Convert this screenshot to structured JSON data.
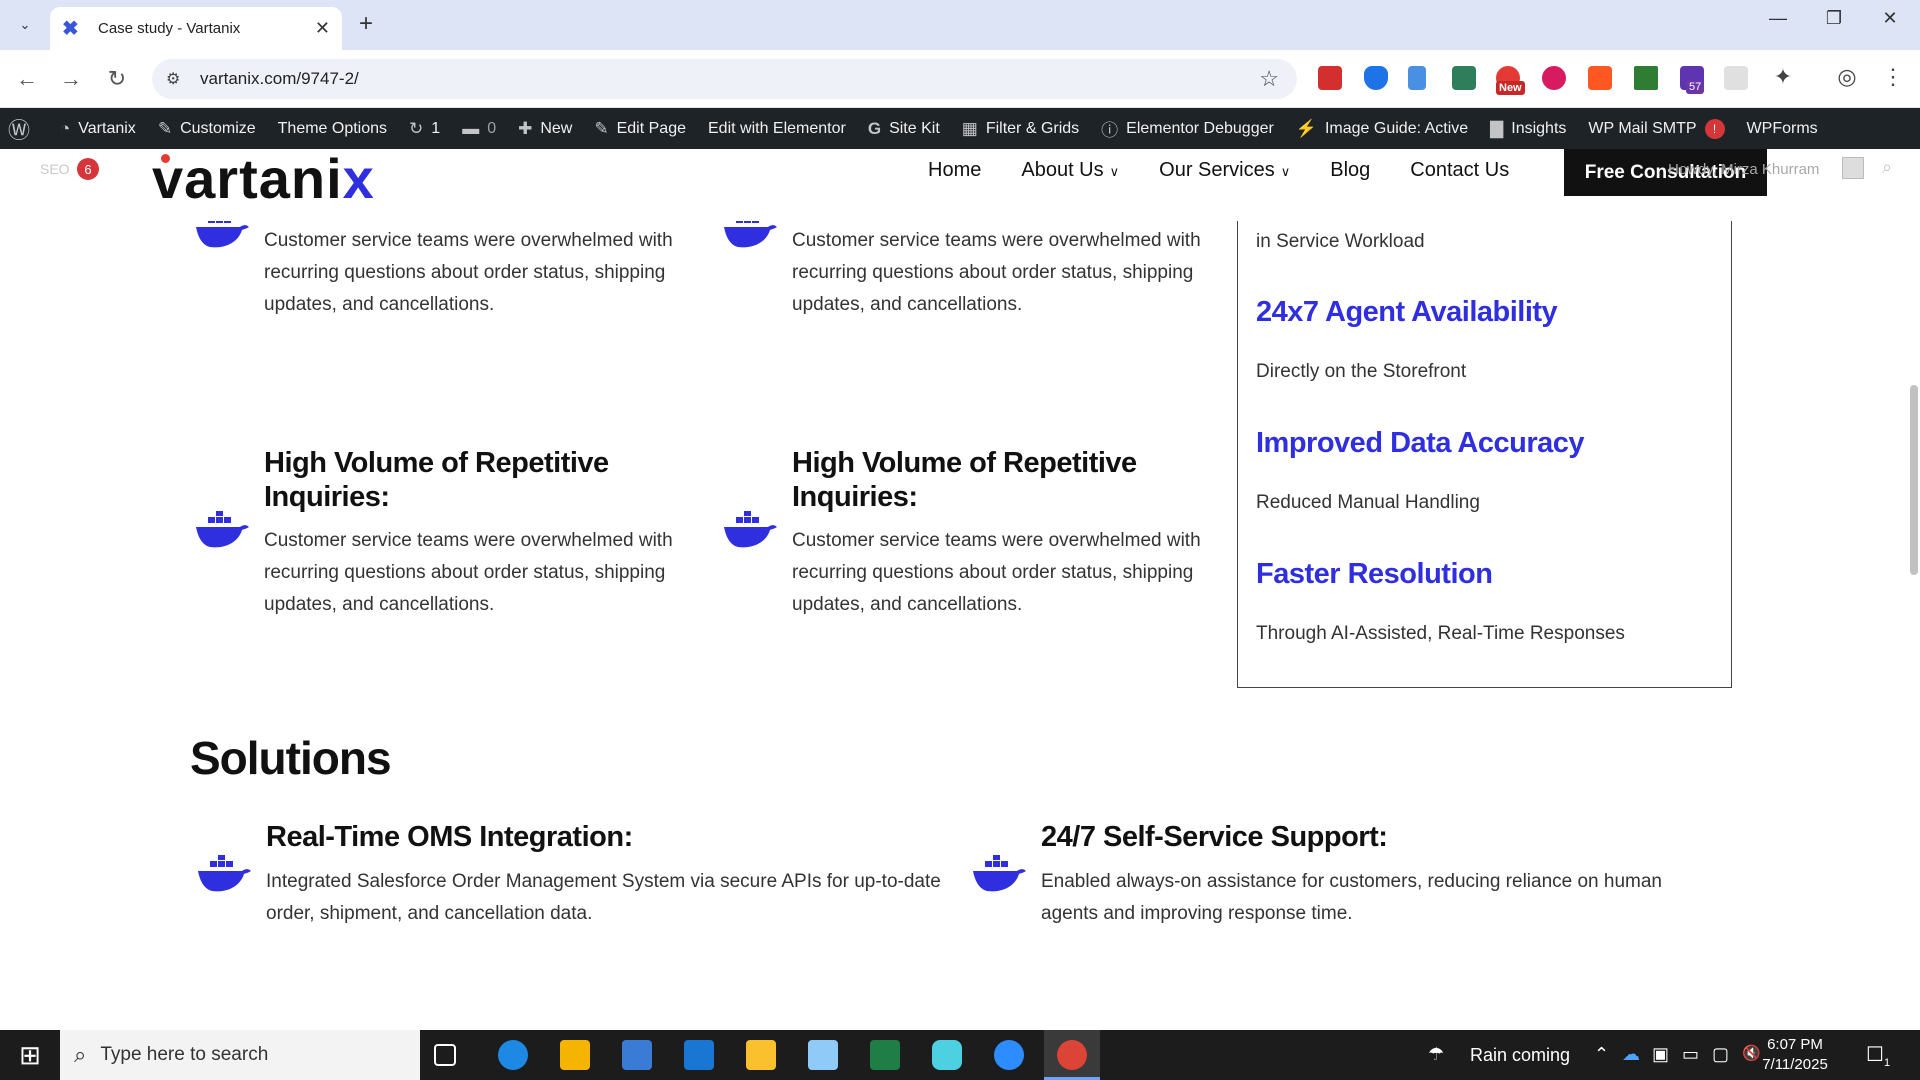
{
  "browser": {
    "tab_title": "Case study - Vartanix",
    "url": "vartanix.com/9747-2/",
    "extension_new_badge": "New",
    "extension_count": "57"
  },
  "adminbar": {
    "site_name": "Vartanix",
    "customize": "Customize",
    "theme_options": "Theme Options",
    "updates_count": "1",
    "comments_count": "0",
    "new": "New",
    "edit_page": "Edit Page",
    "edit_elementor": "Edit with Elementor",
    "site_kit": "Site Kit",
    "filter_grids": "Filter & Grids",
    "elementor_debugger": "Elementor Debugger",
    "image_guide": "Image Guide: Active",
    "insights": "Insights",
    "wp_mail": "WP Mail SMTP",
    "wp_mail_alert": "!",
    "wpforms": "WPForms"
  },
  "header": {
    "seo_label": "SEO",
    "seo_count": "6",
    "logo_main": "vartani",
    "logo_accent": "x",
    "nav": [
      "Home",
      "About Us",
      "Our Services",
      "Blog",
      "Contact Us"
    ],
    "cta": "Free Consultation",
    "howdy": "Howdy, Mirza Khurram"
  },
  "challenges": {
    "top_left_text": "Customer service teams were overwhelmed with recurring questions about order status, shipping updates, and cancellations.",
    "top_mid_text": "Customer service teams were overwhelmed with recurring questions about order status, shipping updates, and cancellations.",
    "bottom_left_title": "High Volume of Repetitive Inquiries:",
    "bottom_left_text": "Customer service teams were overwhelmed with recurring questions about order status, shipping updates, and cancellations.",
    "bottom_mid_title": "High Volume of Repetitive Inquiries:",
    "bottom_mid_text": "Customer service teams were overwhelmed with recurring questions about order status, shipping updates, and cancellations."
  },
  "results": {
    "top_sub": "in Service Workload",
    "items": [
      {
        "head": "24x7 Agent Availability",
        "sub": "Directly on the Storefront"
      },
      {
        "head": "Improved Data Accuracy",
        "sub": "Reduced Manual Handling"
      },
      {
        "head": "Faster Resolution",
        "sub": "Through AI-Assisted, Real-Time Responses"
      }
    ]
  },
  "solutions": {
    "title": "Solutions",
    "left_title": "Real-Time OMS Integration:",
    "left_text": "Integrated Salesforce Order Management System via secure APIs for up-to-date order, shipment, and cancellation data.",
    "right_title": "24/7 Self-Service Support:",
    "right_text": "Enabled always-on assistance for customers, reducing reliance on human agents and improving response time."
  },
  "taskbar": {
    "search_placeholder": "Type here to search",
    "weather": "Rain coming",
    "time": "6:07 PM",
    "date": "7/11/2025",
    "notifications": "1"
  },
  "colors": {
    "accent": "#2f2fe0",
    "adminbar": "#1d2327",
    "taskbar": "#1c1c1c"
  }
}
